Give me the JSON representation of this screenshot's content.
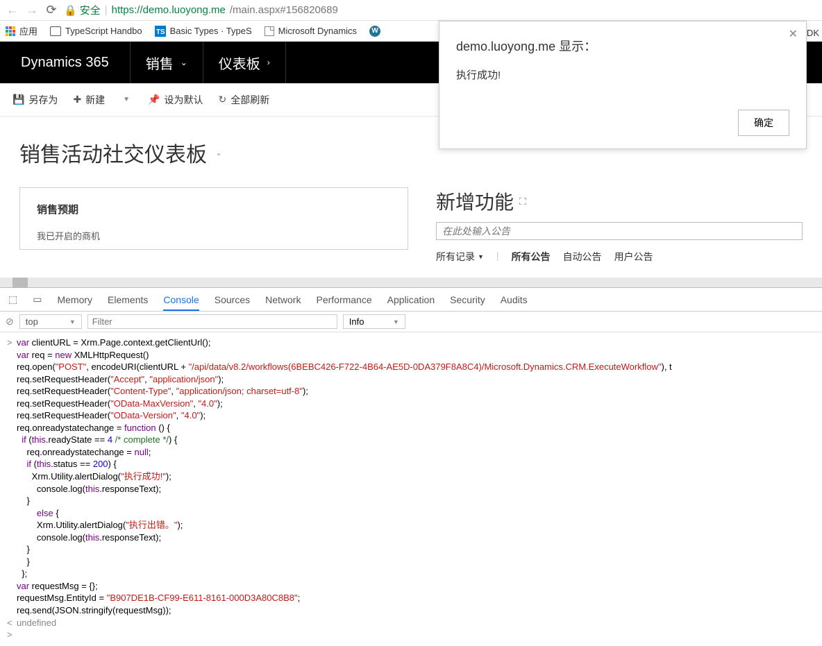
{
  "browser": {
    "secure_label": "安全",
    "url_host": "https://demo.luoyong.me",
    "url_path": "/main.aspx#156820689"
  },
  "bookmarks": {
    "apps": "应用",
    "items": [
      "TypeScript Handbo",
      "Basic Types · TypeS",
      "Microsoft Dynamics"
    ]
  },
  "behind_text": "SDK",
  "header": {
    "logo": "Dynamics 365",
    "nav1": "销售",
    "nav2": "仪表板"
  },
  "commands": {
    "save_as": "另存为",
    "new": "新建",
    "set_default": "设为默认",
    "refresh_all": "全部刷新"
  },
  "page": {
    "title": "销售活动社交仪表板",
    "card_title": "销售预期",
    "card_text": "我已开启的商机",
    "right_title": "新增功能",
    "announce_placeholder": "在此处输入公告",
    "tabs": {
      "all_records": "所有记录",
      "all_posts": "所有公告",
      "auto_posts": "自动公告",
      "user_posts": "用户公告"
    }
  },
  "alert": {
    "title": "demo.luoyong.me 显示：",
    "message": "执行成功!",
    "ok": "确定"
  },
  "devtools": {
    "tabs": [
      "Memory",
      "Elements",
      "Console",
      "Sources",
      "Network",
      "Performance",
      "Application",
      "Security",
      "Audits"
    ],
    "context": "top",
    "filter_placeholder": "Filter",
    "info": "Info",
    "code_lines": [
      {
        "g": ">",
        "html": "<span class='kw'>var</span> clientURL = Xrm.Page.context.getClientUrl();"
      },
      {
        "g": "",
        "html": "<span class='kw'>var</span> req = <span class='new'>new</span> XMLHttpRequest()"
      },
      {
        "g": "",
        "html": "req.open(<span class='str'>\"POST\"</span>, encodeURI(clientURL + <span class='str'>\"/api/data/v8.2/workflows(6BEBC426-F722-4B64-AE5D-0DA379F8A8C4)/Microsoft.Dynamics.CRM.ExecuteWorkflow\"</span>), t"
      },
      {
        "g": "",
        "html": "req.setRequestHeader(<span class='str'>\"Accept\"</span>, <span class='str'>\"application/json\"</span>);"
      },
      {
        "g": "",
        "html": "req.setRequestHeader(<span class='str'>\"Content-Type\"</span>, <span class='str'>\"application/json; charset=utf-8\"</span>);"
      },
      {
        "g": "",
        "html": "req.setRequestHeader(<span class='str'>\"OData-MaxVersion\"</span>, <span class='str'>\"4.0\"</span>);"
      },
      {
        "g": "",
        "html": "req.setRequestHeader(<span class='str'>\"OData-Version\"</span>, <span class='str'>\"4.0\"</span>);"
      },
      {
        "g": "",
        "html": "req.onreadystatechange = <span class='kw'>function</span> () {"
      },
      {
        "g": "",
        "html": "  <span class='kw'>if</span> (<span class='this'>this</span>.readyState == <span class='num'>4</span> <span class='cmnt'>/* complete */</span>) {"
      },
      {
        "g": "",
        "html": "    req.onreadystatechange = <span class='null'>null</span>;"
      },
      {
        "g": "",
        "html": "    <span class='kw'>if</span> (<span class='this'>this</span>.status == <span class='num'>200</span>) {"
      },
      {
        "g": "",
        "html": "      Xrm.Utility.alertDialog(<span class='str'>\"执行成功!\"</span>);"
      },
      {
        "g": "",
        "html": "        console.log(<span class='this'>this</span>.responseText);"
      },
      {
        "g": "",
        "html": "    }"
      },
      {
        "g": "",
        "html": "        <span class='kw'>else</span> {"
      },
      {
        "g": "",
        "html": "        Xrm.Utility.alertDialog(<span class='str'>\"执行出错。\"</span>);"
      },
      {
        "g": "",
        "html": "        console.log(<span class='this'>this</span>.responseText);"
      },
      {
        "g": "",
        "html": "    }"
      },
      {
        "g": "",
        "html": "    }"
      },
      {
        "g": "",
        "html": "  };"
      },
      {
        "g": "",
        "html": "<span class='kw'>var</span> requestMsg = {};"
      },
      {
        "g": "",
        "html": "requestMsg.EntityId = <span class='str'>\"B907DE1B-CF99-E611-8161-000D3A80C8B8\"</span>;"
      },
      {
        "g": "",
        "html": "req.send(JSON.stringify(requestMsg));"
      },
      {
        "g": "<",
        "html": "<span class='undef'>undefined</span>"
      },
      {
        "g": ">",
        "html": ""
      }
    ]
  }
}
